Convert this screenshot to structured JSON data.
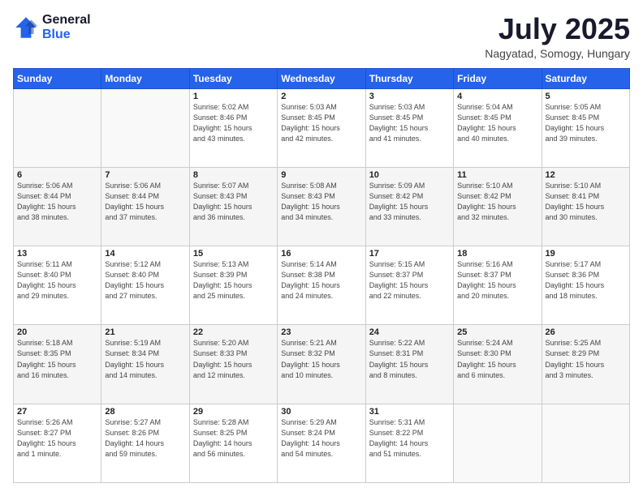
{
  "header": {
    "logo_line1": "General",
    "logo_line2": "Blue",
    "month": "July 2025",
    "location": "Nagyatad, Somogy, Hungary"
  },
  "weekdays": [
    "Sunday",
    "Monday",
    "Tuesday",
    "Wednesday",
    "Thursday",
    "Friday",
    "Saturday"
  ],
  "weeks": [
    [
      {
        "day": "",
        "info": ""
      },
      {
        "day": "",
        "info": ""
      },
      {
        "day": "1",
        "info": "Sunrise: 5:02 AM\nSunset: 8:46 PM\nDaylight: 15 hours\nand 43 minutes."
      },
      {
        "day": "2",
        "info": "Sunrise: 5:03 AM\nSunset: 8:45 PM\nDaylight: 15 hours\nand 42 minutes."
      },
      {
        "day": "3",
        "info": "Sunrise: 5:03 AM\nSunset: 8:45 PM\nDaylight: 15 hours\nand 41 minutes."
      },
      {
        "day": "4",
        "info": "Sunrise: 5:04 AM\nSunset: 8:45 PM\nDaylight: 15 hours\nand 40 minutes."
      },
      {
        "day": "5",
        "info": "Sunrise: 5:05 AM\nSunset: 8:45 PM\nDaylight: 15 hours\nand 39 minutes."
      }
    ],
    [
      {
        "day": "6",
        "info": "Sunrise: 5:06 AM\nSunset: 8:44 PM\nDaylight: 15 hours\nand 38 minutes."
      },
      {
        "day": "7",
        "info": "Sunrise: 5:06 AM\nSunset: 8:44 PM\nDaylight: 15 hours\nand 37 minutes."
      },
      {
        "day": "8",
        "info": "Sunrise: 5:07 AM\nSunset: 8:43 PM\nDaylight: 15 hours\nand 36 minutes."
      },
      {
        "day": "9",
        "info": "Sunrise: 5:08 AM\nSunset: 8:43 PM\nDaylight: 15 hours\nand 34 minutes."
      },
      {
        "day": "10",
        "info": "Sunrise: 5:09 AM\nSunset: 8:42 PM\nDaylight: 15 hours\nand 33 minutes."
      },
      {
        "day": "11",
        "info": "Sunrise: 5:10 AM\nSunset: 8:42 PM\nDaylight: 15 hours\nand 32 minutes."
      },
      {
        "day": "12",
        "info": "Sunrise: 5:10 AM\nSunset: 8:41 PM\nDaylight: 15 hours\nand 30 minutes."
      }
    ],
    [
      {
        "day": "13",
        "info": "Sunrise: 5:11 AM\nSunset: 8:40 PM\nDaylight: 15 hours\nand 29 minutes."
      },
      {
        "day": "14",
        "info": "Sunrise: 5:12 AM\nSunset: 8:40 PM\nDaylight: 15 hours\nand 27 minutes."
      },
      {
        "day": "15",
        "info": "Sunrise: 5:13 AM\nSunset: 8:39 PM\nDaylight: 15 hours\nand 25 minutes."
      },
      {
        "day": "16",
        "info": "Sunrise: 5:14 AM\nSunset: 8:38 PM\nDaylight: 15 hours\nand 24 minutes."
      },
      {
        "day": "17",
        "info": "Sunrise: 5:15 AM\nSunset: 8:37 PM\nDaylight: 15 hours\nand 22 minutes."
      },
      {
        "day": "18",
        "info": "Sunrise: 5:16 AM\nSunset: 8:37 PM\nDaylight: 15 hours\nand 20 minutes."
      },
      {
        "day": "19",
        "info": "Sunrise: 5:17 AM\nSunset: 8:36 PM\nDaylight: 15 hours\nand 18 minutes."
      }
    ],
    [
      {
        "day": "20",
        "info": "Sunrise: 5:18 AM\nSunset: 8:35 PM\nDaylight: 15 hours\nand 16 minutes."
      },
      {
        "day": "21",
        "info": "Sunrise: 5:19 AM\nSunset: 8:34 PM\nDaylight: 15 hours\nand 14 minutes."
      },
      {
        "day": "22",
        "info": "Sunrise: 5:20 AM\nSunset: 8:33 PM\nDaylight: 15 hours\nand 12 minutes."
      },
      {
        "day": "23",
        "info": "Sunrise: 5:21 AM\nSunset: 8:32 PM\nDaylight: 15 hours\nand 10 minutes."
      },
      {
        "day": "24",
        "info": "Sunrise: 5:22 AM\nSunset: 8:31 PM\nDaylight: 15 hours\nand 8 minutes."
      },
      {
        "day": "25",
        "info": "Sunrise: 5:24 AM\nSunset: 8:30 PM\nDaylight: 15 hours\nand 6 minutes."
      },
      {
        "day": "26",
        "info": "Sunrise: 5:25 AM\nSunset: 8:29 PM\nDaylight: 15 hours\nand 3 minutes."
      }
    ],
    [
      {
        "day": "27",
        "info": "Sunrise: 5:26 AM\nSunset: 8:27 PM\nDaylight: 15 hours\nand 1 minute."
      },
      {
        "day": "28",
        "info": "Sunrise: 5:27 AM\nSunset: 8:26 PM\nDaylight: 14 hours\nand 59 minutes."
      },
      {
        "day": "29",
        "info": "Sunrise: 5:28 AM\nSunset: 8:25 PM\nDaylight: 14 hours\nand 56 minutes."
      },
      {
        "day": "30",
        "info": "Sunrise: 5:29 AM\nSunset: 8:24 PM\nDaylight: 14 hours\nand 54 minutes."
      },
      {
        "day": "31",
        "info": "Sunrise: 5:31 AM\nSunset: 8:22 PM\nDaylight: 14 hours\nand 51 minutes."
      },
      {
        "day": "",
        "info": ""
      },
      {
        "day": "",
        "info": ""
      }
    ]
  ]
}
